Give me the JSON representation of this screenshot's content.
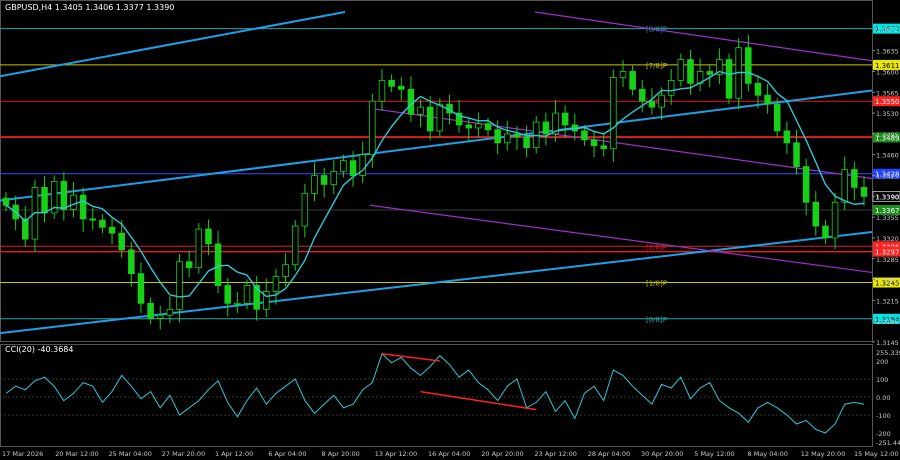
{
  "header": {
    "main_title": "GBPUSD,H4  1.3405 1.3406 1.3377 1.3390",
    "cci_title": "CCI(20) -40.3684"
  },
  "chart_data": [
    {
      "type": "candlestick",
      "symbol": "GBPUSD",
      "timeframe": "H4",
      "ohlc_last": [
        1.3405,
        1.3406,
        1.3377,
        1.339
      ],
      "ylim": [
        1.3145,
        1.37
      ],
      "y_ticks": [
        "1.3672",
        "1.3635",
        "1.3600",
        "1.3565",
        "1.3530",
        "1.3495",
        "1.3460",
        "1.3425",
        "1.3390",
        "1.3355",
        "1.3320",
        "1.3285",
        "1.3250",
        "1.3215",
        "1.3180",
        "1.3145"
      ],
      "x_ticks": [
        "17 Mar 2026",
        "20 Mar 12:00",
        "25 Mar 04:00",
        "27 Mar 20:00",
        "1 Apr 12:00",
        "6 Apr 04:00",
        "8 Apr 20:00",
        "13 Apr 12:00",
        "16 Apr 04:00",
        "20 Apr 20:00",
        "23 Apr 12:00",
        "28 Apr 04:00",
        "30 Apr 20:00",
        "5 May 12:00",
        "8 May 04:00",
        "12 May 20:00",
        "15 May 12:00"
      ],
      "closes": [
        1.3375,
        1.3352,
        1.3318,
        1.3405,
        1.3362,
        1.3415,
        1.3368,
        1.3392,
        1.3352,
        1.335,
        1.3338,
        1.3328,
        1.33,
        1.326,
        1.321,
        1.3185,
        1.319,
        1.32,
        1.328,
        1.327,
        1.3335,
        1.331,
        1.324,
        1.321,
        1.321,
        1.324,
        1.32,
        1.323,
        1.3255,
        1.3275,
        1.334,
        1.3395,
        1.3425,
        1.341,
        1.3432,
        1.345,
        1.3425,
        1.346,
        1.355,
        1.3585,
        1.3575,
        1.357,
        1.3528,
        1.354,
        1.35,
        1.3545,
        1.353,
        1.351,
        1.3505,
        1.3512,
        1.3502,
        1.348,
        1.3495,
        1.349,
        1.3472,
        1.3515,
        1.3495,
        1.353,
        1.351,
        1.35,
        1.3485,
        1.3475,
        1.347,
        1.359,
        1.36,
        1.357,
        1.355,
        1.354,
        1.356,
        1.3585,
        1.362,
        1.358,
        1.36,
        1.3595,
        1.362,
        1.3555,
        1.364,
        1.358,
        1.356,
        1.3545,
        1.35,
        1.348,
        1.344,
        1.338,
        1.334,
        1.332,
        1.338,
        1.3435,
        1.3405,
        1.339
      ],
      "levels": [
        {
          "label": "[8/8]P",
          "value": 1.3672,
          "color": "#20a8a8",
          "box": "#00e5e5"
        },
        {
          "label": "[7/8]P",
          "value": 1.3611,
          "color": "#c8c800",
          "box": "#e8e800"
        },
        {
          "label": "[6/8]P",
          "value": 1.355,
          "color": "#e02020",
          "box": "#ff2020"
        },
        {
          "label": "",
          "value": 1.3489,
          "color": "#e02020",
          "box": "#1c8c1c"
        },
        {
          "label": "",
          "value": 1.3428,
          "color": "#3050ff",
          "box": "#2040ff"
        },
        {
          "label": "",
          "value": 1.3367,
          "color": "#3b3b3b",
          "box": "#1c8c1c"
        },
        {
          "label": "[2/8]P",
          "value": 1.3306,
          "color": "#e02020",
          "box": "#ff2020"
        },
        {
          "label": "[1/8]P",
          "value": 1.3245,
          "color": "#c8c800",
          "box": "#e8e800"
        },
        {
          "label": "[0/8]P",
          "value": 1.3184,
          "color": "#20a8a8",
          "box": "#00e5e5"
        }
      ],
      "extra_hlines": [
        {
          "value": 1.349,
          "color": "#e02020"
        },
        {
          "value": 1.3297,
          "color": "#e02020"
        }
      ],
      "price_boxes": [
        {
          "label": "1.3672",
          "value": 1.3672,
          "color": "#00e5e5",
          "text": "#000"
        },
        {
          "label": "1.3611",
          "value": 1.3611,
          "color": "#e8e800",
          "text": "#000"
        },
        {
          "label": "1.3550",
          "value": 1.355,
          "color": "#ff2020",
          "text": "#fff"
        },
        {
          "label": "1.3489",
          "value": 1.3489,
          "color": "#1c8c1c",
          "text": "#fff"
        },
        {
          "label": "1.3428",
          "value": 1.3428,
          "color": "#2040ff",
          "text": "#fff"
        },
        {
          "label": "1.3390",
          "value": 1.339,
          "color": "#000000",
          "text": "#fff"
        },
        {
          "label": "1.3367",
          "value": 1.3367,
          "color": "#1c8c1c",
          "text": "#fff"
        },
        {
          "label": "1.3306",
          "value": 1.3306,
          "color": "#ff2020",
          "text": "#fff"
        },
        {
          "label": "1.3297",
          "value": 1.3297,
          "color": "#ff2020",
          "text": "#fff"
        },
        {
          "label": "1.3245",
          "value": 1.3245,
          "color": "#e8e800",
          "text": "#000"
        },
        {
          "label": "1.3184",
          "value": 1.3184,
          "color": "#00e5e5",
          "text": "#000"
        }
      ],
      "colors": {
        "candle": "#18d018",
        "ma": "#2ec8d8",
        "trend": "#1ea0e8",
        "channel": "#9b30c8",
        "background": "#000000",
        "grid_text": "#c8c8c8"
      }
    },
    {
      "type": "line",
      "title": "CCI(20) -40.3684",
      "ylim": [
        -250,
        250
      ],
      "y_ticks": [
        "255.3396",
        "200",
        "100",
        "0.00",
        "-100",
        "-200",
        "-251.4431"
      ],
      "values": [
        20,
        60,
        40,
        90,
        110,
        60,
        -20,
        20,
        80,
        60,
        -30,
        30,
        120,
        60,
        -10,
        30,
        -60,
        10,
        -100,
        -60,
        -20,
        40,
        90,
        -30,
        -110,
        -20,
        50,
        -40,
        20,
        60,
        100,
        -20,
        -90,
        -40,
        10,
        -60,
        -40,
        40,
        80,
        240,
        190,
        220,
        160,
        120,
        170,
        230,
        180,
        110,
        150,
        80,
        40,
        -20,
        60,
        100,
        -60,
        -30,
        30,
        -80,
        -20,
        -120,
        20,
        60,
        -20,
        150,
        120,
        60,
        10,
        -40,
        70,
        50,
        110,
        -10,
        50,
        80,
        -20,
        -60,
        -90,
        -140,
        -60,
        -30,
        -60,
        -100,
        -150,
        -130,
        -180,
        -200,
        -150,
        -40,
        -30,
        -40
      ],
      "divergence_color": "#ff2020"
    }
  ]
}
